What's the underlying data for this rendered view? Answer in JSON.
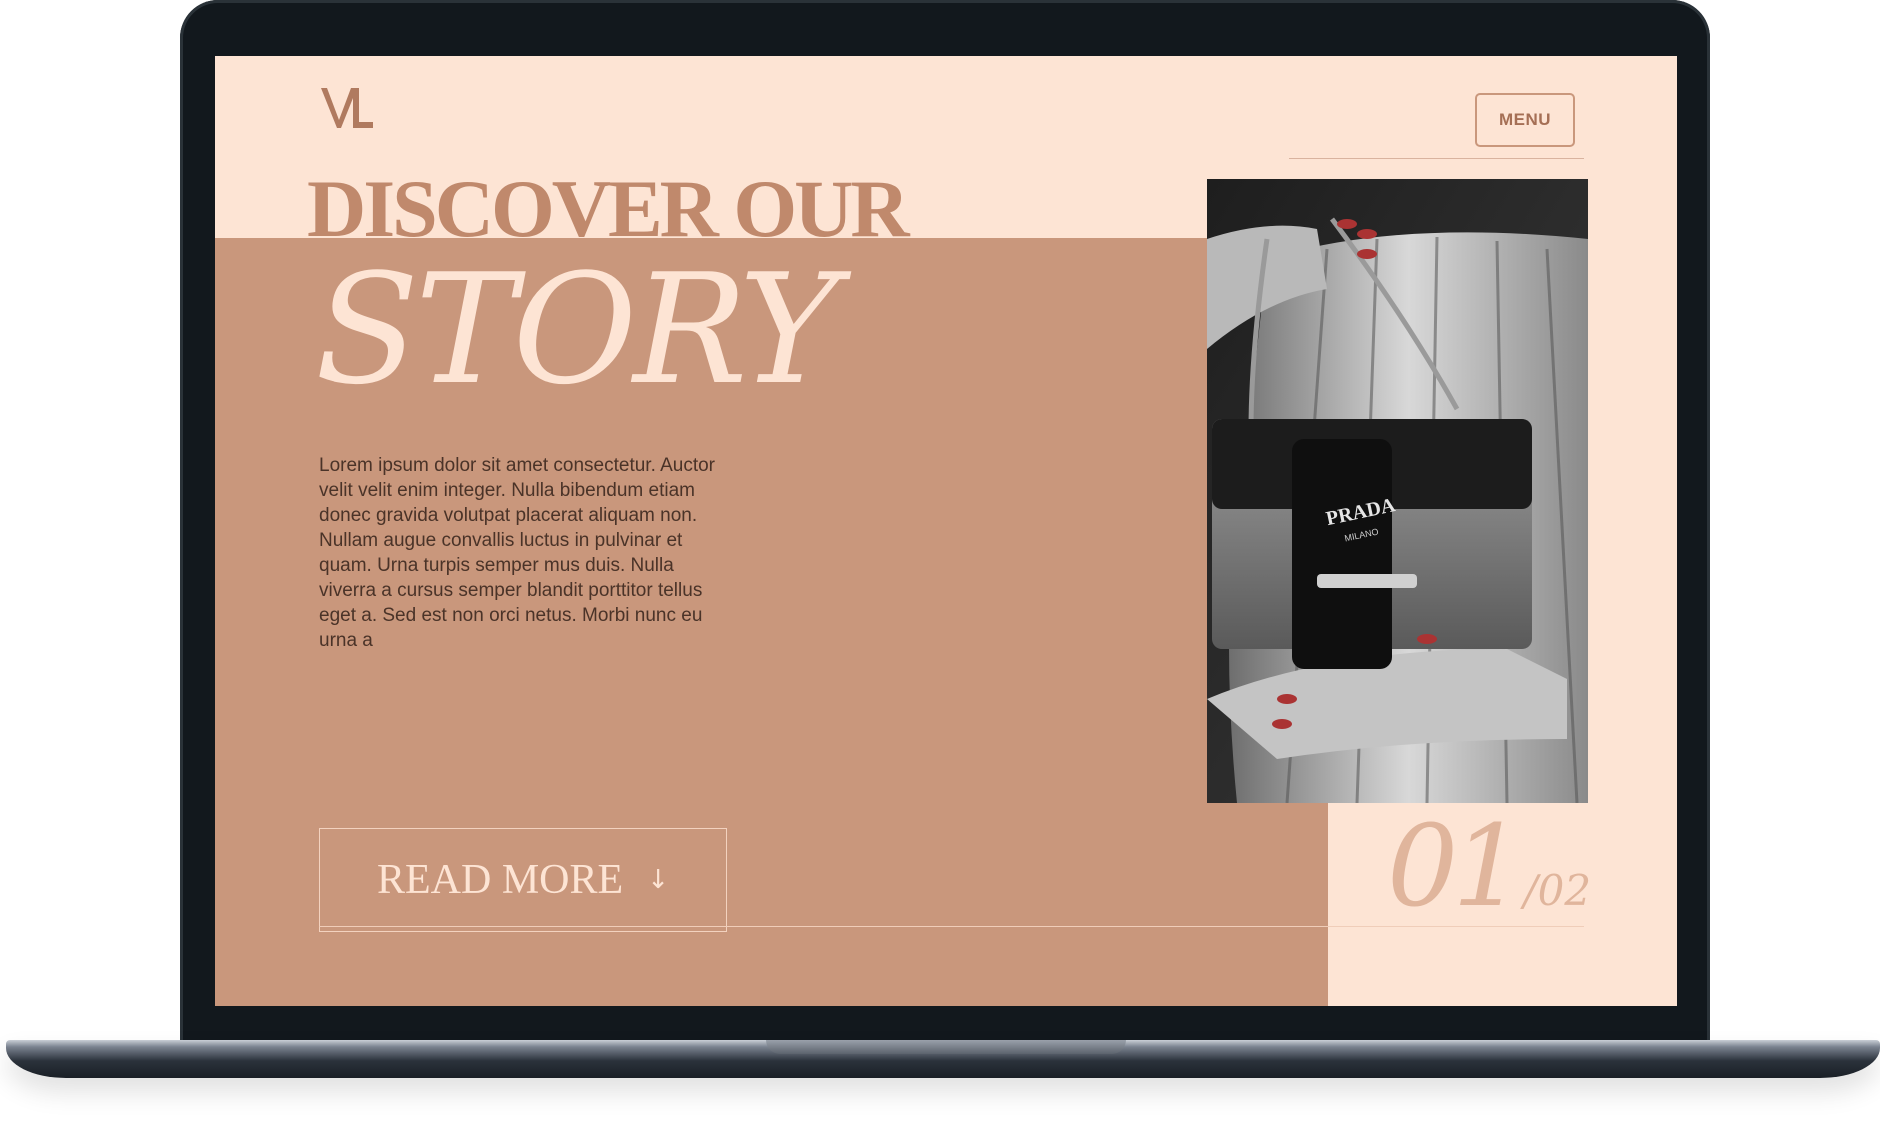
{
  "site": {
    "logo_text": "VL"
  },
  "header": {
    "menu_label": "MENU"
  },
  "hero": {
    "headline_top": "DISCOVER OUR",
    "headline_main": "STORY",
    "body": "Lorem ipsum dolor sit amet consectetur. Auctor velit velit enim integer. Nulla bibendum etiam donec gravida volutpat placerat aliquam non. Nullam augue convallis luctus in pulvinar et quam. Urna turpis semper mus duis. Nulla viverra a cursus semper blandit porttitor tellus eget a. Sed est non orci netus. Morbi nunc eu urna a",
    "read_more_label": "READ MORE",
    "read_more_icon": "arrow-down-icon"
  },
  "photo": {
    "bag_brand": "PRADA",
    "bag_sub": "MILANO"
  },
  "pagination": {
    "current": "01",
    "total": "/02"
  },
  "colors": {
    "cream": "#fde4d4",
    "tan": "#c9977c",
    "accent": "#c0896c",
    "text_dark": "#4a3328"
  }
}
